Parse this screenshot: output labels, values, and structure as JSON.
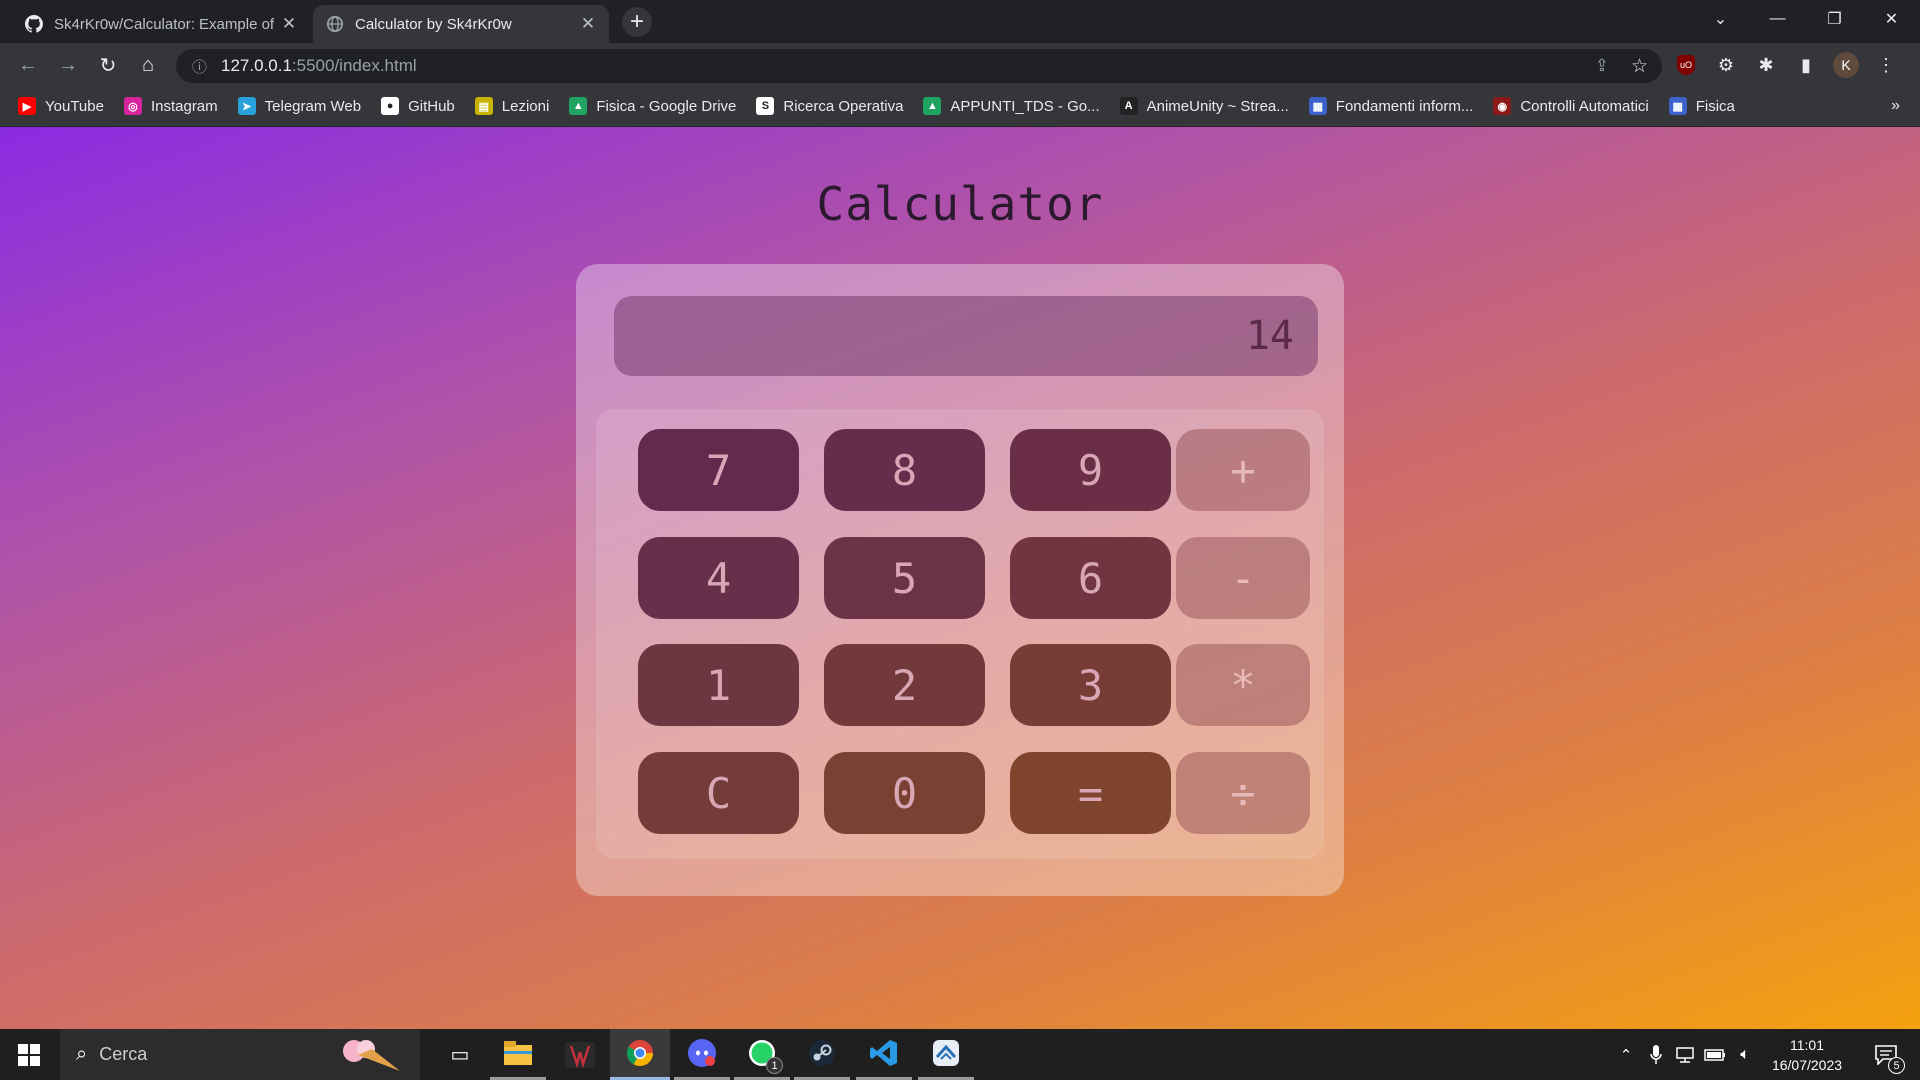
{
  "browser": {
    "tabs": [
      {
        "title": "Sk4rKr0w/Calculator: Example of",
        "icon": "github-icon"
      },
      {
        "title": "Calculator by Sk4rKr0w",
        "icon": "globe-icon"
      }
    ],
    "url_host": "127.0.0.1",
    "url_path": ":5500/index.html",
    "profile_initial": "K",
    "bookmarks": [
      {
        "label": "YouTube",
        "icon": "youtube-icon",
        "color": "#ff0000"
      },
      {
        "label": "Instagram",
        "icon": "instagram-icon",
        "color": "#d6249f"
      },
      {
        "label": "Telegram Web",
        "icon": "telegram-icon",
        "color": "#2aa1da"
      },
      {
        "label": "GitHub",
        "icon": "github-icon",
        "color": "#ffffff"
      },
      {
        "label": "Lezioni",
        "icon": "folder-icon",
        "color": "#c8b400"
      },
      {
        "label": "Fisica - Google Drive",
        "icon": "google-drive-icon",
        "color": "#1fa463"
      },
      {
        "label": "Ricerca Operativa",
        "icon": "scribd-icon",
        "color": "#ffffff"
      },
      {
        "label": "APPUNTI_TDS - Go...",
        "icon": "google-drive-icon",
        "color": "#1fa463"
      },
      {
        "label": "AnimeUnity ~ Strea...",
        "icon": "animeunity-icon",
        "color": "#222222"
      },
      {
        "label": "Fondamenti inform...",
        "icon": "moodle-icon",
        "color": "#3a62c8"
      },
      {
        "label": "Controlli Automatici",
        "icon": "university-icon",
        "color": "#8b1a1a"
      },
      {
        "label": "Fisica",
        "icon": "moodle-icon",
        "color": "#3a62c8"
      }
    ]
  },
  "page": {
    "title": "Calculator",
    "display_value": "14",
    "keys": [
      {
        "label": "7",
        "kind": "digit",
        "bg": "#632a4e"
      },
      {
        "label": "8",
        "kind": "digit",
        "bg": "#662c4b"
      },
      {
        "label": "9",
        "kind": "digit",
        "bg": "#6a2e46"
      },
      {
        "label": "+",
        "kind": "operator"
      },
      {
        "label": "4",
        "kind": "digit",
        "bg": "#67304a"
      },
      {
        "label": "5",
        "kind": "digit",
        "bg": "#6b3345"
      },
      {
        "label": "6",
        "kind": "digit",
        "bg": "#703540"
      },
      {
        "label": "-",
        "kind": "operator"
      },
      {
        "label": "1",
        "kind": "digit",
        "bg": "#6d3640"
      },
      {
        "label": "2",
        "kind": "digit",
        "bg": "#72393b"
      },
      {
        "label": "3",
        "kind": "digit",
        "bg": "#773c36"
      },
      {
        "label": "*",
        "kind": "operator"
      },
      {
        "label": "C",
        "kind": "clear",
        "bg": "#743c38"
      },
      {
        "label": "0",
        "kind": "digit",
        "bg": "#7a4032"
      },
      {
        "label": "=",
        "kind": "equals",
        "bg": "#7e442c"
      },
      {
        "label": "÷",
        "kind": "operator"
      }
    ]
  },
  "taskbar": {
    "search_placeholder": "Cerca",
    "time": "11:01",
    "date": "16/07/2023",
    "notification_count": "5",
    "whatsapp_badge": "1"
  }
}
